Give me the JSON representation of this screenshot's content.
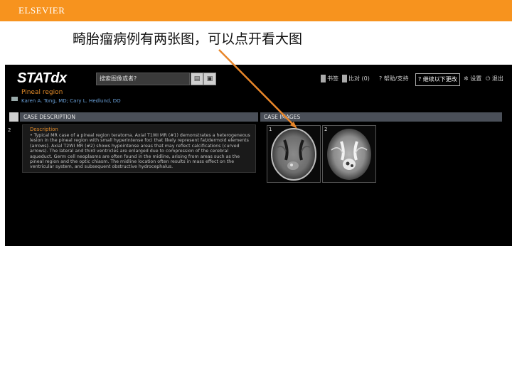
{
  "slide": {
    "brand": "ELSEVIER",
    "title": "畸胎瘤病例有两张图，可以点开看大图"
  },
  "app": {
    "logo": "STATdx",
    "search_placeholder": "搜索图像或者?",
    "nav": [
      {
        "label": "书签",
        "icon": "bookmark-icon"
      },
      {
        "label": "比对 (0)",
        "icon": "compare-icon"
      },
      {
        "label": "帮助/支持",
        "icon": "help-icon"
      },
      {
        "label": "继续以下更改",
        "icon": "settings-icon"
      },
      {
        "label": "设置",
        "icon": "gear-icon"
      },
      {
        "label": "退出",
        "icon": "power-icon"
      }
    ]
  },
  "case": {
    "title": "Pineal region",
    "authors": "Karen A. Tong, MD; Cary L. Hedlund, DO",
    "description_header": "CASE DESCRIPTION",
    "images_header": "CASE IMAGES",
    "description_label": "Description",
    "description_text": "Typical MR case of a pineal region teratoma. Axial T1WI MR (#1) demonstrates a heterogeneous lesion in the pineal region with small hyperintense foci that likely represent fat/dermoid elements (arrows). Axial T2WI MR (#2) shows hypointense areas that may reflect calcifications (curved arrows). The lateral and third ventricles are enlarged due to compression of the cerebral aqueduct. Germ cell neoplasms are often found in the midline, arising from areas such as the pineal region and the optic chiasm. The midline location often results in mass effect on the ventricular system, and subsequent obstructive hydrocephalus.",
    "sidebar_number": "2",
    "images": [
      {
        "number": "1",
        "sequence": "T1WI"
      },
      {
        "number": "2",
        "sequence": "T2WI"
      }
    ]
  },
  "colors": {
    "brand_bar": "#f7931e",
    "arrow": "#e8862a",
    "case_title": "#e08a2a",
    "author_link": "#6aa0d8"
  }
}
